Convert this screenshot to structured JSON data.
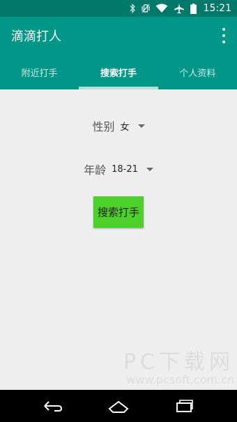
{
  "status_bar": {
    "time": "15:21",
    "icons": [
      "bluetooth-icon",
      "vibrate-icon",
      "wifi-icon",
      "airplane-icon",
      "battery-icon"
    ]
  },
  "app_bar": {
    "title": "滴滴打人",
    "menu_icon": "overflow-menu-icon"
  },
  "tabs": [
    {
      "label": "附近打手",
      "active": false
    },
    {
      "label": "搜索打手",
      "active": true
    },
    {
      "label": "个人资料",
      "active": false
    }
  ],
  "form": {
    "gender": {
      "label": "性别",
      "value": "女"
    },
    "age": {
      "label": "年龄",
      "value": "18-21"
    },
    "search_button": "搜索打手"
  },
  "watermark": {
    "main": "PC下载网",
    "domain": "www.pcsoft.com.cn"
  },
  "nav_bar": {
    "icons": [
      "back-icon",
      "home-icon",
      "recent-apps-icon"
    ]
  },
  "colors": {
    "status_bar": "#00796b",
    "primary": "#009688",
    "tab_indicator": "#b2dfdb",
    "button": "#4cd12b",
    "background": "#eeeeee"
  }
}
